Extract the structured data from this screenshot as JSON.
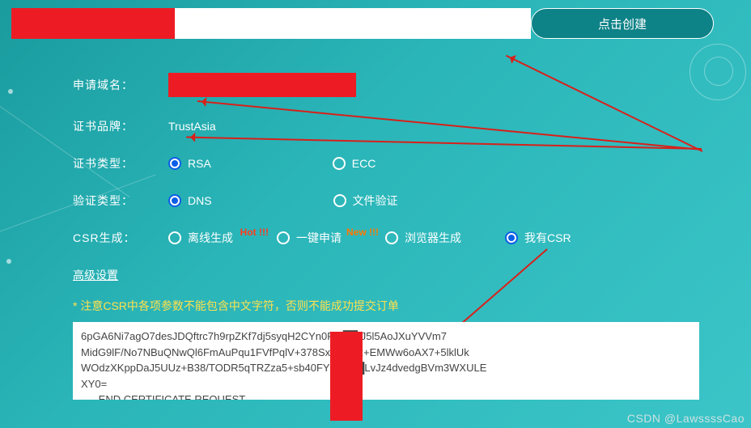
{
  "topbar": {
    "create_button": "点击创建"
  },
  "form": {
    "domain_label": "申请域名：",
    "brand_label": "证书品牌：",
    "brand_value": "TrustAsia",
    "cert_type_label": "证书类型：",
    "cert_type_options": {
      "rsa": "RSA",
      "ecc": "ECC"
    },
    "verify_type_label": "验证类型：",
    "verify_type_options": {
      "dns": "DNS",
      "file": "文件验证"
    },
    "csr_gen_label": "CSR生成：",
    "csr_gen_options": {
      "offline": "离线生成",
      "oneclick": "一键申请",
      "browser": "浏览器生成",
      "have": "我有CSR"
    },
    "badges": {
      "hot": "Hot !!!",
      "new": "New !!!"
    },
    "advanced": "高级设置",
    "warning": "* 注意CSR中各项参数不能包含中文字符，否则不能成功提交订单",
    "csr_text": "6pGA6Ni7agO7desJDQftrc7h9rpZKf7dj5syqH2CYn0Rpj██:J5l5AoJXuYVVm7\nMidG9lF/No7NBuQNwQl6FmAuPqu1FVfPqlV+378SxA8██z+EMWw6oAX7+5lklUk\nWOdzXKppDaJ5UUz+B38/TODR5qTRZza5+sb40FYF1███LvJz4dvedgBVm3WXULE\nXY0=\n-----END CERTIFICATE REQUEST-----"
  },
  "watermark": "CSDN @LawssssCao"
}
